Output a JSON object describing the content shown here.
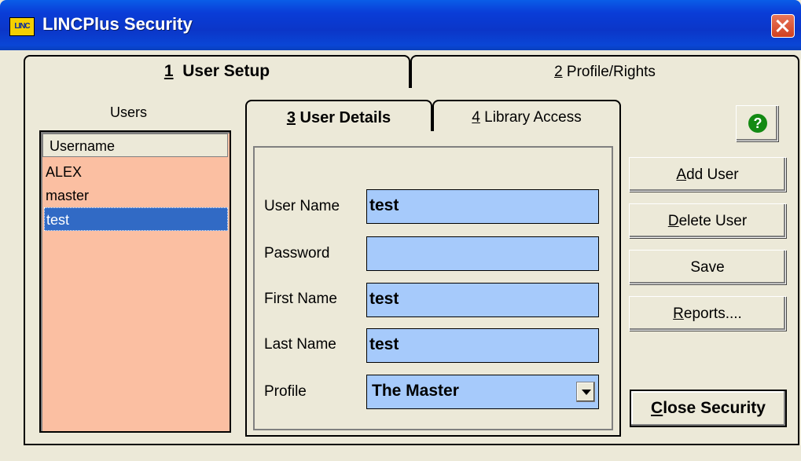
{
  "window": {
    "title": "LINCPlus Security",
    "icon_label": "LINC"
  },
  "main_tabs": [
    {
      "number": "1",
      "label": "User Setup",
      "active": true
    },
    {
      "number": "2",
      "label": "Profile/Rights",
      "active": false
    }
  ],
  "users_panel": {
    "label": "Users",
    "column_header": "Username",
    "rows": [
      "ALEX",
      "master",
      "test"
    ],
    "selected": "test"
  },
  "detail_tabs": [
    {
      "number": "3",
      "label": "User Details",
      "active": true
    },
    {
      "number": "4",
      "label": "Library Access",
      "active": false
    }
  ],
  "form": {
    "user_name_label": "User Name",
    "user_name_value": "test",
    "password_label": "Password",
    "password_value": "",
    "first_name_label": "First Name",
    "first_name_value": "test",
    "last_name_label": "Last Name",
    "last_name_value": "test",
    "profile_label": "Profile",
    "profile_value": "The Master"
  },
  "buttons": {
    "help_icon": "?",
    "add_user": {
      "accel": "A",
      "rest": "dd User"
    },
    "delete_user": {
      "accel": "D",
      "rest": "elete User"
    },
    "save": "Save",
    "reports": {
      "accel": "R",
      "rest": "eports...."
    },
    "close_security": {
      "accel": "C",
      "rest": "lose Security"
    }
  },
  "colors": {
    "list_bg": "#fbbfa2",
    "field_bg": "#a6cafb",
    "selection": "#316ac5",
    "titlebar": "#0a46d6"
  }
}
